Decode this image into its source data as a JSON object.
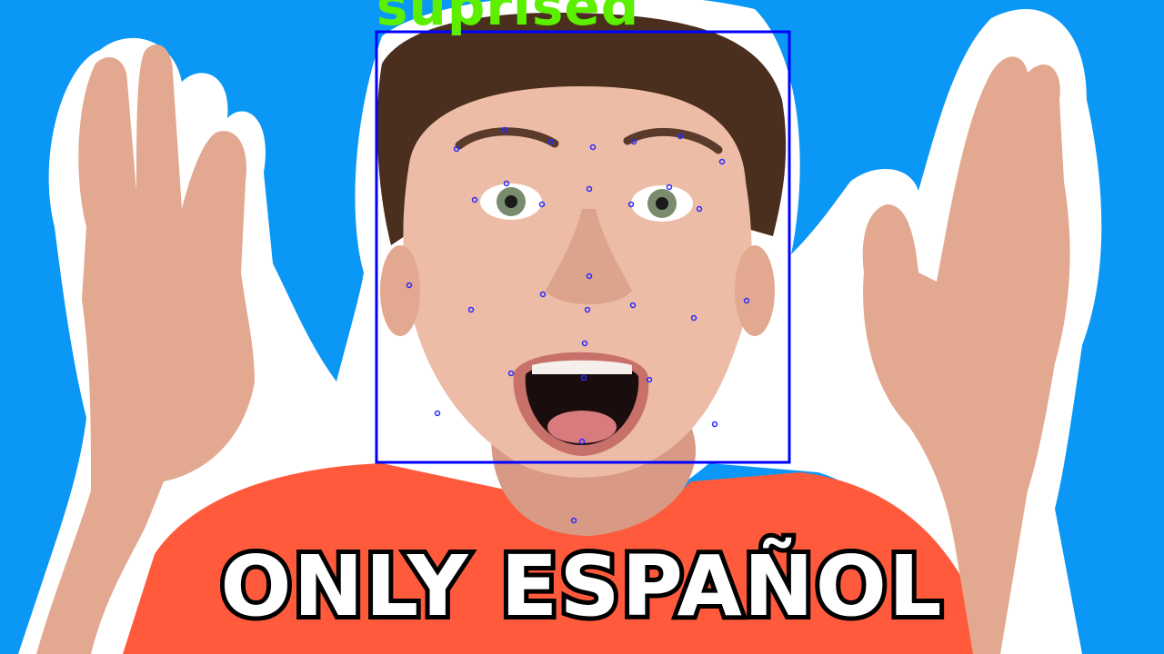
{
  "detection": {
    "emotion_label": "suprised",
    "box_color": "#0000ff",
    "label_color": "#5cf000"
  },
  "caption": {
    "text": "ONLY ESPAÑOL"
  },
  "colors": {
    "background": "#0a97f5",
    "shirt": "#ff5a3c",
    "outline": "#ffffff",
    "skin": "#e8b9a3",
    "hair": "#4a2e1e"
  }
}
